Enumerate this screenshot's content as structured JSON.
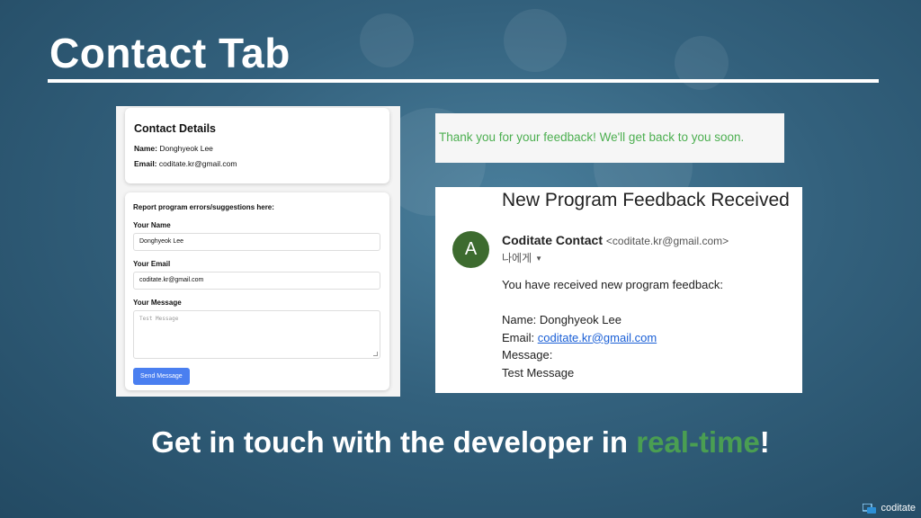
{
  "slide": {
    "title": "Contact Tab",
    "tagline_before": "Get in touch with the developer in ",
    "tagline_accent": "real-time",
    "tagline_after": "!",
    "accent_color": "#4a9e52"
  },
  "contact_details": {
    "heading": "Contact Details",
    "name_label": "Name:",
    "name_value": "Donghyeok Lee",
    "email_label": "Email:",
    "email_value": "coditate.kr@gmail.com"
  },
  "feedback_form": {
    "intro": "Report program errors/suggestions here:",
    "name_label": "Your Name",
    "name_value": "Donghyeok Lee",
    "email_label": "Your Email",
    "email_value": "coditate.kr@gmail.com",
    "message_label": "Your Message",
    "message_placeholder": "Test Message",
    "send_label": "Send Message",
    "button_color": "#4a7ff0"
  },
  "confirmation": {
    "text": "Thank you for your feedback! We'll get back to you soon.",
    "color": "#4caf50"
  },
  "email": {
    "subject": "New Program Feedback Received",
    "avatar_letter": "A",
    "sender_name": "Coditate Contact",
    "sender_address": "<coditate.kr@gmail.com>",
    "to_label": "나에게",
    "body_intro": "You have received new program feedback:",
    "name_line": "Name: Donghyeok Lee",
    "email_label": "Email:",
    "email_link": "coditate.kr@gmail.com",
    "message_label": "Message:",
    "message_text": "Test Message",
    "avatar_color": "#3d6b2f"
  },
  "logo": {
    "text": "coditate",
    "icon": "coditate-logo-icon"
  }
}
